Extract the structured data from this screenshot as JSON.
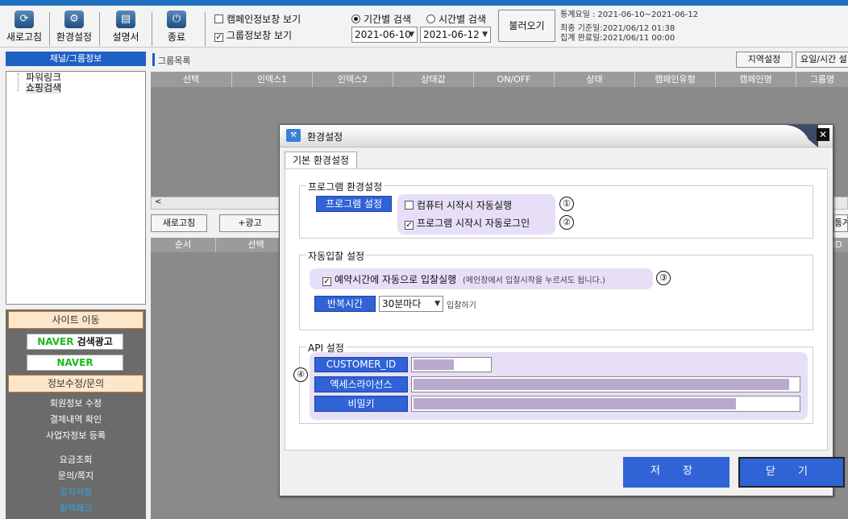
{
  "toolbar": {
    "buttons": [
      {
        "label": "새로고침"
      },
      {
        "label": "환경설정"
      },
      {
        "label": "설명서"
      },
      {
        "label": "종료"
      }
    ],
    "check_campaign": "캠페인정보창 보기",
    "check_group": "그룹정보창 보기",
    "radio_period": "기간별 검색",
    "radio_time": "시간별 검색",
    "date_from": "2021-06-10",
    "date_to": "2021-06-12",
    "load_button": "불러오기",
    "stats_line1": "통계요일 : 2021-06-10~2021-06-12",
    "stats_line2": "최종 기준일:2021/06/12 01:38",
    "stats_line3": "집계 완료일:2021/06/11 00:00"
  },
  "left": {
    "header": "채널/그룹정보",
    "tree": [
      "파워링크",
      "쇼핑검색"
    ],
    "site_move": "사이트 이동",
    "naver_ad": "NAVER 검색광고",
    "naver": "NAVER",
    "info_header": "정보수정/문의",
    "menu": [
      "회원정보 수정",
      "결제내역 확인",
      "사업자정보 등록",
      "요금조회",
      "문의/쪽지",
      "공지사항",
      "릴렉패크"
    ]
  },
  "main": {
    "group_list": "그룹목록",
    "region_button": "지역설정",
    "weekday_button": "요일/시간 설",
    "columns": [
      "선택",
      "인덱스1",
      "인덱스2",
      "상태값",
      "ON/OFF",
      "상태",
      "캠페인유형",
      "캠페인명",
      "그룹명"
    ],
    "refresh_button": "새로고침",
    "add_ad_button": "+광고",
    "right_button": "통계",
    "lower_columns": [
      "순서",
      "선택"
    ],
    "lower_right_col": "ID"
  },
  "dialog": {
    "title": "환경설정",
    "tab": "기본 환경설정",
    "group1_title": "프로그램 환경설정",
    "program_setting_btn": "프로그램 설정",
    "auto_start": "컴퓨터 시작시 자동실행",
    "auto_login": "프로그램 시작시 자동로그인",
    "circle1": "①",
    "circle2": "②",
    "circle3": "③",
    "circle4": "④",
    "group2_title": "자동입찰 설정",
    "auto_bid": "예약시간에 자동으로 입찰실행",
    "auto_bid_hint": "(메인창에서 입찰시작을 누르셔도 됩니다.)",
    "repeat_label": "반복시간",
    "repeat_value": "30분마다",
    "bid_do": "입찰하기",
    "group3_title": "API 설정",
    "api_customer": "CUSTOMER_ID",
    "api_access": "엑세스라이선스",
    "api_secret": "비밀키",
    "save": "저 장",
    "close": "닫 기"
  },
  "colors": {
    "accent_blue": "#2f63d6",
    "lavender": "#e6dff7",
    "masked": "#b9a9cf",
    "orange_header": "#fde7cc"
  }
}
